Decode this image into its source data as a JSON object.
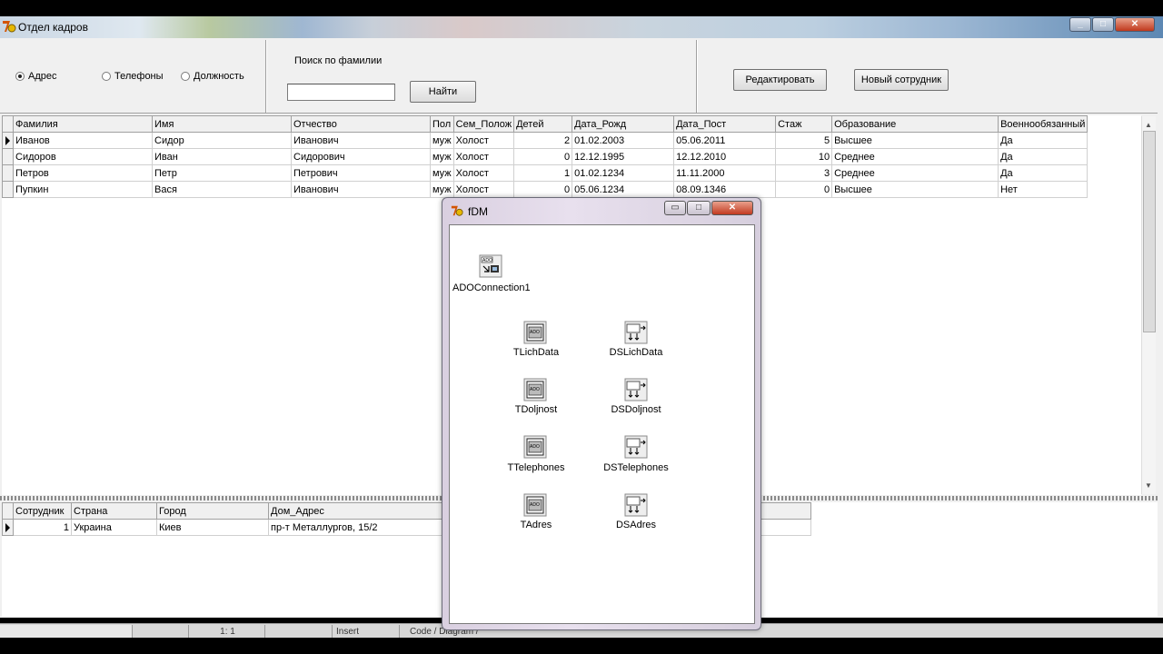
{
  "main_window": {
    "title": "Отдел кадров",
    "controls": [
      "_",
      "□",
      "✕"
    ]
  },
  "filter": {
    "radios": [
      {
        "label": "Адрес",
        "selected": true
      },
      {
        "label": "Телефоны",
        "selected": false
      },
      {
        "label": "Должность",
        "selected": false
      }
    ],
    "search_label": "Поиск по фамилии",
    "search_value": "",
    "find_button": "Найти",
    "edit_button": "Редактировать",
    "new_button": "Новый сотрудник"
  },
  "employees_grid": {
    "columns": [
      "Фамилия",
      "Имя",
      "Отчество",
      "Пол",
      "Сем_Полож",
      "Детей",
      "Дата_Рожд",
      "Дата_Пост",
      "Стаж",
      "Образование",
      "Военнообязанный"
    ],
    "rows": [
      [
        "Иванов",
        "Сидор",
        "Иванович",
        "муж",
        "Холост",
        "2",
        "01.02.2003",
        "05.06.2011",
        "5",
        "Высшее",
        "Да"
      ],
      [
        "Сидоров",
        "Иван",
        "Сидорович",
        "муж",
        "Холост",
        "0",
        "12.12.1995",
        "12.12.2010",
        "10",
        "Среднее",
        "Да"
      ],
      [
        "Петров",
        "Петр",
        "Петрович",
        "муж",
        "Холост",
        "1",
        "01.02.1234",
        "11.11.2000",
        "3",
        "Среднее",
        "Да"
      ],
      [
        "Пупкин",
        "Вася",
        "Иванович",
        "муж",
        "Холост",
        "0",
        "05.06.1234",
        "08.09.1346",
        "0",
        "Высшее",
        "Нет"
      ]
    ]
  },
  "address_grid": {
    "columns": [
      "Сотрудник",
      "Страна",
      "Город",
      "Дом_Адрес"
    ],
    "rows": [
      [
        "1",
        "Украина",
        "Киев",
        "пр-т Металлургов, 15/2"
      ]
    ]
  },
  "statusbar": {
    "position": "1:  1",
    "mode": "Insert",
    "tabs": "Code / Diagram /"
  },
  "fdm_window": {
    "title": "fDM",
    "controls": [
      "▭",
      "□",
      "✕"
    ],
    "connection": {
      "label": "ADOConnection1",
      "icon": "ado-connection-icon"
    },
    "components": [
      {
        "table": "TLichData",
        "dataset": "DSLichData"
      },
      {
        "table": "TDoljnost",
        "dataset": "DSDoljnost"
      },
      {
        "table": "TTelephones",
        "dataset": "DSTelephones"
      },
      {
        "table": "TAdres",
        "dataset": "DSAdres"
      }
    ]
  }
}
